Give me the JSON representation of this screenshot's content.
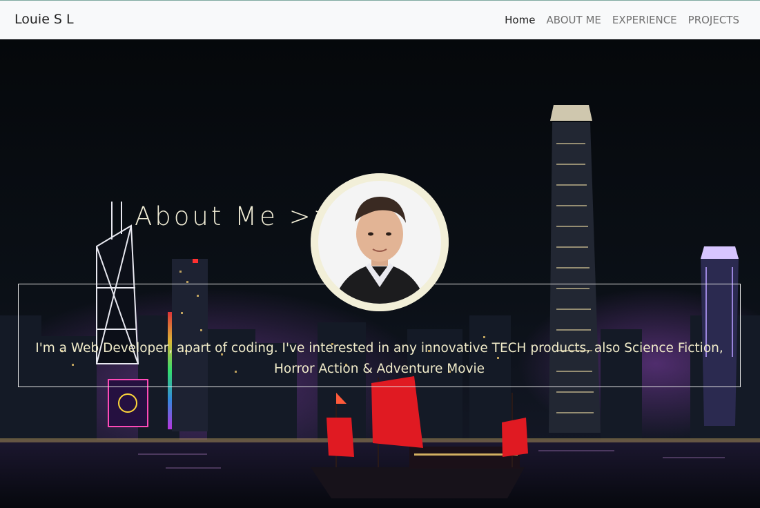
{
  "nav": {
    "brand": "Louie S L",
    "links": [
      "Home",
      "ABOUT ME",
      "EXPERIENCE",
      "PROJECTS"
    ]
  },
  "hero": {
    "about_title": "About Me >>>",
    "description": "I'm a Web Developer, apart of coding. I've interested in any innovative TECH products, also Science Fiction, Horror Action & Adventure Movie"
  },
  "colors": {
    "navbar_bg": "#f8f9fa",
    "hero_text": "#f0ebc9",
    "avatar_ring": "#f2efd8",
    "sail_red": "#e01a22"
  }
}
